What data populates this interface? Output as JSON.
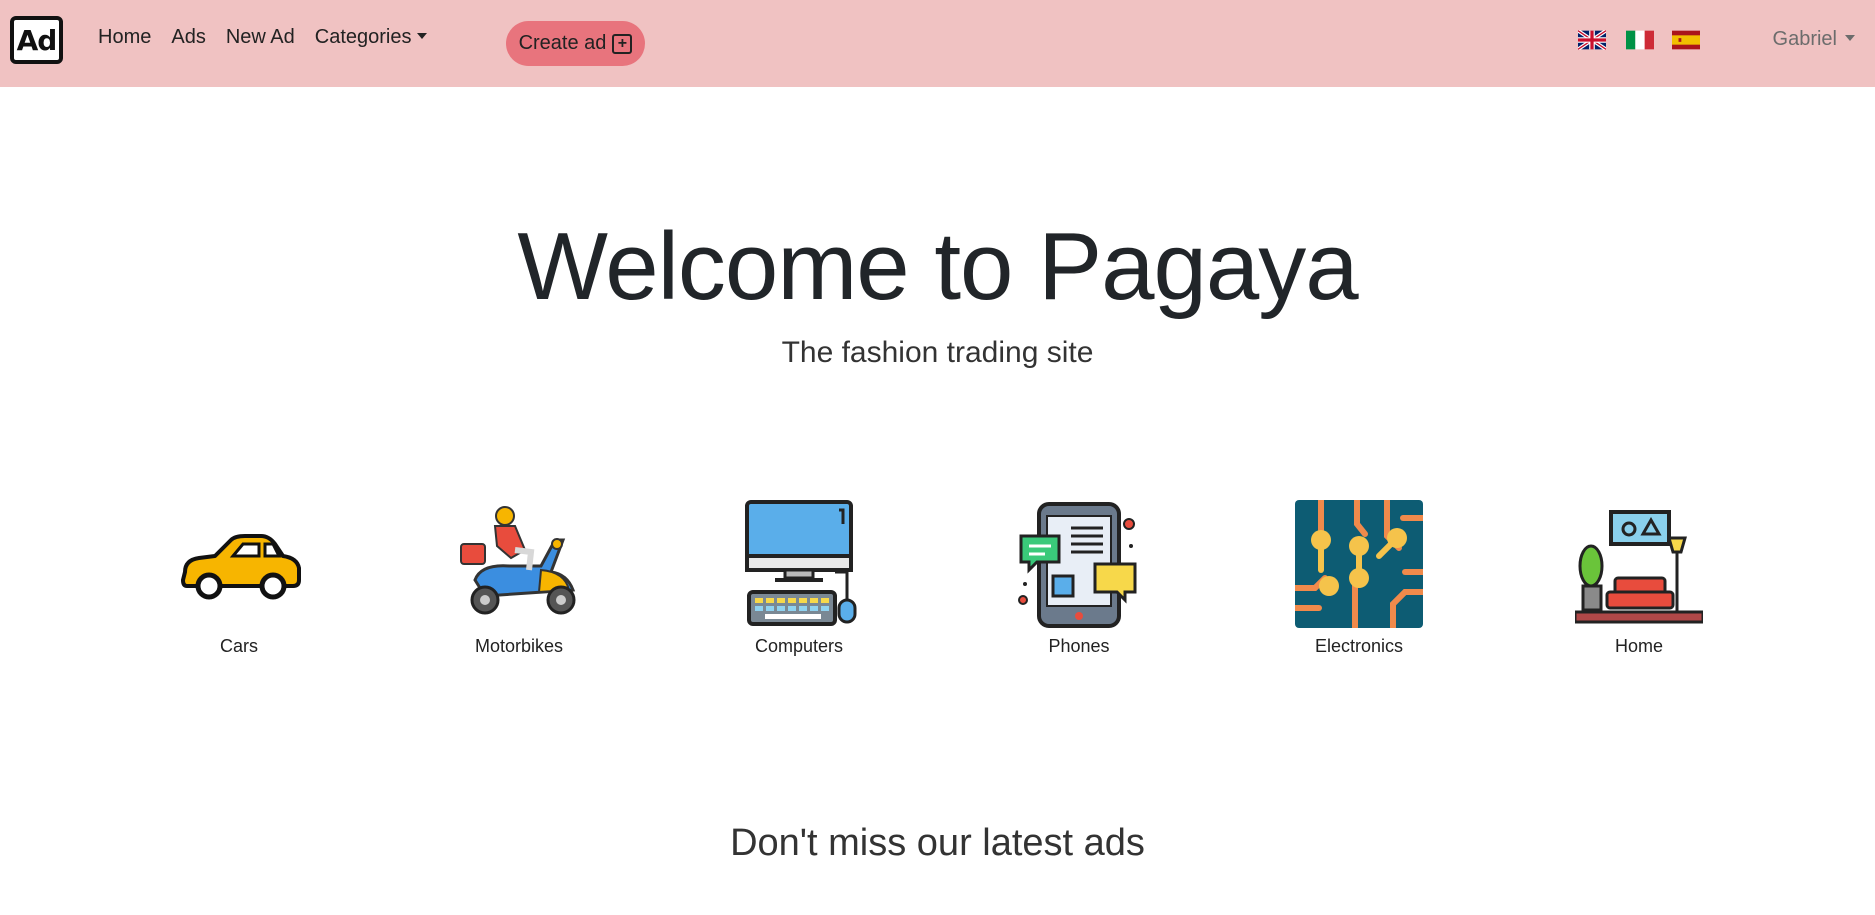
{
  "navbar": {
    "brand": "Ad",
    "links": [
      "Home",
      "Ads",
      "New Ad",
      "Categories"
    ],
    "create_button": "Create ad",
    "flags": [
      "uk-flag-icon",
      "italy-flag-icon",
      "spain-flag-icon"
    ],
    "user": "Gabriel",
    "background": "#f0c2c2",
    "accent": "#e8747d"
  },
  "hero": {
    "title": "Welcome to Pagaya",
    "subtitle": "The fashion trading site"
  },
  "categories": [
    {
      "label": "Cars",
      "icon": "car-icon"
    },
    {
      "label": "Motorbikes",
      "icon": "scooter-icon"
    },
    {
      "label": "Computers",
      "icon": "computer-icon"
    },
    {
      "label": "Phones",
      "icon": "phone-icon"
    },
    {
      "label": "Electronics",
      "icon": "circuit-icon"
    },
    {
      "label": "Home",
      "icon": "living-room-icon"
    }
  ],
  "latest": {
    "heading": "Don't miss our latest ads"
  }
}
